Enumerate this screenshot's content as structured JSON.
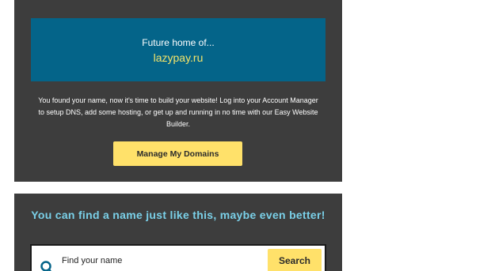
{
  "parked": {
    "lead_text": "Future home of...",
    "domain": "lazypay.ru",
    "description": "You found your name, now it's time to build your website! Log into your Account Manager to setup DNS, add some hosting, or get up and running in no time with our Easy Website Builder.",
    "manage_button": "Manage My Domains"
  },
  "search": {
    "headline": "You can find a name just like this, maybe even better!",
    "placeholder": "Find your name",
    "button": "Search"
  },
  "colors": {
    "panel_bg": "#3d3d3d",
    "banner_bg": "#046489",
    "domain_text": "#f5e56a",
    "button_yellow": "#ffe16a",
    "headline_text": "#7ad0e8"
  },
  "icons": {
    "search": "magnifier-icon"
  }
}
